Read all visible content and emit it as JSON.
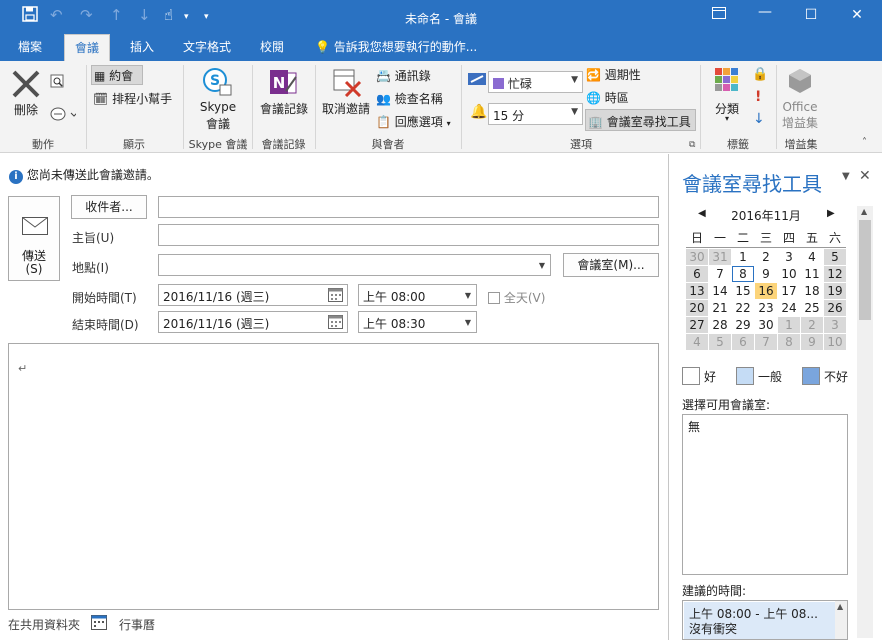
{
  "window": {
    "title": "未命名 - 會議"
  },
  "tabs": [
    "檔案",
    "會議",
    "插入",
    "文字格式",
    "校閱"
  ],
  "tell_me": "告訴我您想要執行的動作...",
  "ribbon": {
    "delete_label": "刪除",
    "appointment_label": "約會",
    "scheduling_label": "排程小幫手",
    "skype_label": "Skype",
    "skype_label2": "會議",
    "meeting_notes_label": "會議記錄",
    "cancel_invite_label": "取消邀請",
    "address_book_label": "通訊錄",
    "check_names_label": "檢查名稱",
    "response_options_label": "回應選項",
    "show_as_value": "忙碌",
    "reminder_value": "15 分",
    "recurrence_label": "週期性",
    "timezones_label": "時區",
    "room_finder_label": "會議室尋找工具",
    "categorize_label": "分類",
    "office_addins_label": "Office",
    "office_addins_label2": "增益集",
    "groups": {
      "actions": "動作",
      "show": "顯示",
      "skype": "Skype 會議",
      "meeting_notes": "會議記錄",
      "attendees": "與會者",
      "options": "選項",
      "tags": "標籤",
      "addins": "增益集"
    }
  },
  "form": {
    "info_message": "您尚未傳送此會議邀請。",
    "send_label": "傳送",
    "send_label2": "(S)",
    "to_button": "收件者...",
    "subject_label": "主旨(U)",
    "location_label": "地點(I)",
    "rooms_button": "會議室(M)...",
    "start_label": "開始時間(T)",
    "end_label": "結束時間(D)",
    "start_date": "2016/11/16 (週三)",
    "start_time": "上午 08:00",
    "end_date": "2016/11/16 (週三)",
    "end_time": "上午 08:30",
    "allday_label": "全天(V)",
    "body_mark": "↵"
  },
  "status": {
    "shared_folder": "在共用資料夾",
    "calendar": "行事曆"
  },
  "pane": {
    "title": "會議室尋找工具",
    "month": "2016年11月",
    "weekdays": [
      "日",
      "一",
      "二",
      "三",
      "四",
      "五",
      "六"
    ],
    "weeks": [
      [
        "30",
        "31",
        "1",
        "2",
        "3",
        "4",
        "5"
      ],
      [
        "6",
        "7",
        "8",
        "9",
        "10",
        "11",
        "12"
      ],
      [
        "13",
        "14",
        "15",
        "16",
        "17",
        "18",
        "19"
      ],
      [
        "20",
        "21",
        "22",
        "23",
        "24",
        "25",
        "26"
      ],
      [
        "27",
        "28",
        "29",
        "30",
        "1",
        "2",
        "3"
      ],
      [
        "4",
        "5",
        "6",
        "7",
        "8",
        "9",
        "10"
      ]
    ],
    "legend_good": "好",
    "legend_fair": "一般",
    "legend_poor": "不好",
    "rooms_label": "選擇可用會議室:",
    "rooms_value": "無",
    "suggested_label": "建議的時間:",
    "suggested_time": "上午 08:00 - 上午 08...",
    "suggested_note": "沒有衝突"
  },
  "colors": {
    "accent": "#2a72c2",
    "today": "#fcd47a",
    "busy_swatch": "#8a6bd1",
    "legend_fair": "#c5dcf5",
    "legend_poor": "#7aa5dd",
    "weekend_bg": "#d9d9d9"
  }
}
